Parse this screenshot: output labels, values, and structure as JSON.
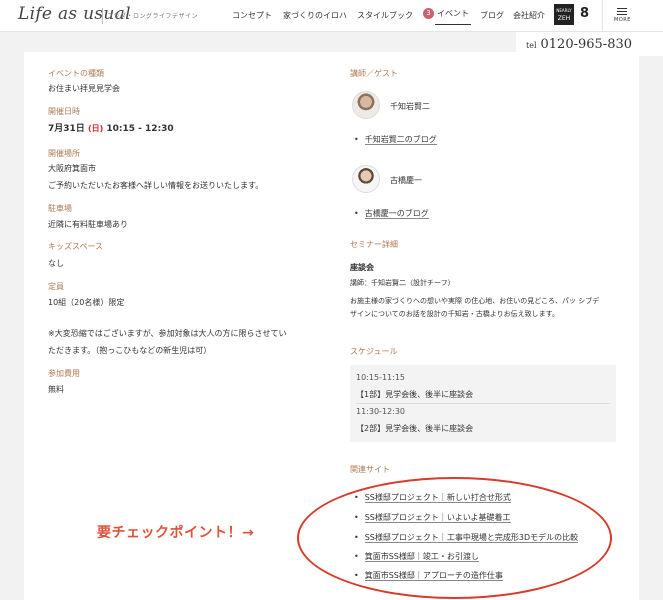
{
  "header": {
    "logo": "Life as usual",
    "logo_sub": "フラダ・ロングライフデザイン",
    "nav": [
      "コンセプト",
      "家づくりのイロハ",
      "スタイルブック",
      "イベント",
      "ブログ",
      "会社紹介"
    ],
    "event_badge": "3",
    "zeh_small": "NEARLY",
    "zeh_label": "ZEH",
    "eight_label": "8",
    "menu_label": "MORE"
  },
  "tel": {
    "prefix": "tel",
    "number": "0120-965-830"
  },
  "event": {
    "type_label": "イベントの種類",
    "type_value": "お住まい拝見見学会",
    "date_label": "開催日時",
    "date_day": "7月31日",
    "date_dow": "(日)",
    "date_time": "10:15 - 12:30",
    "place_label": "開催場所",
    "place_value": "大阪府箕面市",
    "place_note": "ご予約いただいたお客様へ詳しい情報をお送りいたします。",
    "parking_label": "駐車場",
    "parking_value": "近隣に有料駐車場あり",
    "kids_label": "キッズスペース",
    "kids_value": "なし",
    "capacity_label": "定員",
    "capacity_value": "10組（20名様）限定",
    "notice_line1": "※大変恐縮ではございますが、参加対象は大人の方に限らさせてい",
    "notice_line2": "ただきます。（抱っこひもなどの新生児は可）",
    "fee_label": "参加費用",
    "fee_value": "無料"
  },
  "guests": {
    "label": "講師／ゲスト",
    "items": [
      {
        "name": "千知岩賢二",
        "blog": "千知岩賢二のブログ"
      },
      {
        "name": "古橋慶一",
        "blog": "古橋慶一のブログ"
      }
    ]
  },
  "seminar": {
    "label": "セミナー詳細",
    "title": "座談会",
    "speaker": "講師：千知岩賢二（設計チーフ）",
    "desc_line1": "お施主様の家づくりへの想いや実際 の住心地、お住いの見どころ、パッ シブデ",
    "desc_line2": "ザインについてのお話を設計の千知岩・古橋よりお伝え致します。"
  },
  "schedule": {
    "label": "スケジュール",
    "items": [
      {
        "time": "10:15-11:15",
        "title": "【1部】見学会後、後半に座談会"
      },
      {
        "time": "11:30-12:30",
        "title": "【2部】見学会後、後半に座談会"
      }
    ]
  },
  "related": {
    "label": "関連サイト",
    "links": [
      "SS様邸プロジェクト｜新しい打合せ形式",
      "SS様邸プロジェクト｜いよいよ基礎着工",
      "SS様邸プロジェクト｜工事中現場と完成形3Dモデルの比較",
      "箕面市SS様邸｜竣工・お引渡し",
      "箕面市SS様邸｜アプローチの造作仕事"
    ]
  },
  "annotation": {
    "callout": "要チェックポイント！→",
    "color": "#d93a2b"
  },
  "colors": {
    "label_accent": "#b07a50",
    "badge": "#c9606a",
    "dow": "#cc2233"
  }
}
